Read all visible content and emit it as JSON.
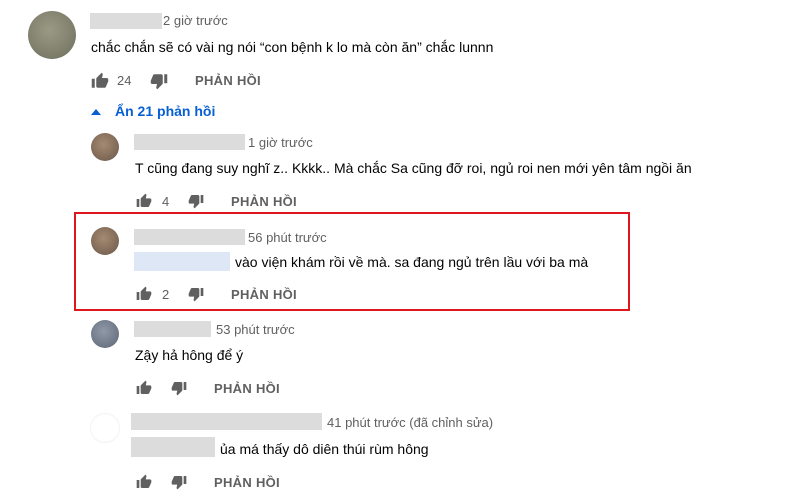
{
  "comments": [
    {
      "time": "2 giờ trước",
      "text": "chắc chắn sẽ có vài ng nói “con bệnh k lo mà còn ăn” chắc lunnn",
      "likes": "24",
      "reply_label": "PHẢN HỒI"
    },
    {
      "time": "1 giờ trước",
      "text": "T cũng đang suy nghĩ z.. Kkkk.. Mà chắc Sa cũng đỡ roi, ngủ roi nen mới yên tâm ngồi ăn",
      "likes": "4",
      "reply_label": "PHẢN HỒI"
    },
    {
      "time": "56 phút trước",
      "text": "vào viện khám rồi về mà. sa đang ngủ trên lầu với ba mà",
      "likes": "2",
      "reply_label": "PHẢN HỒI"
    },
    {
      "time": "53 phút trước",
      "text": "Zậy hả hông để ý",
      "likes": "",
      "reply_label": "PHẢN HỒI"
    },
    {
      "time": "41 phút trước (đã chỉnh sửa)",
      "text": "ủa má thấy dô diên thúi rùm hông",
      "likes": "",
      "reply_label": "PHẢN HỒI"
    }
  ],
  "toggle": {
    "label": "Ẩn 21 phản hồi"
  },
  "colors": {
    "accent": "#065fd4",
    "highlight_border": "#e0161e",
    "meta": "#606060"
  },
  "icons": {
    "like": "thumbs-up-icon",
    "dislike": "thumbs-down-icon",
    "collapse": "caret-up-icon"
  }
}
